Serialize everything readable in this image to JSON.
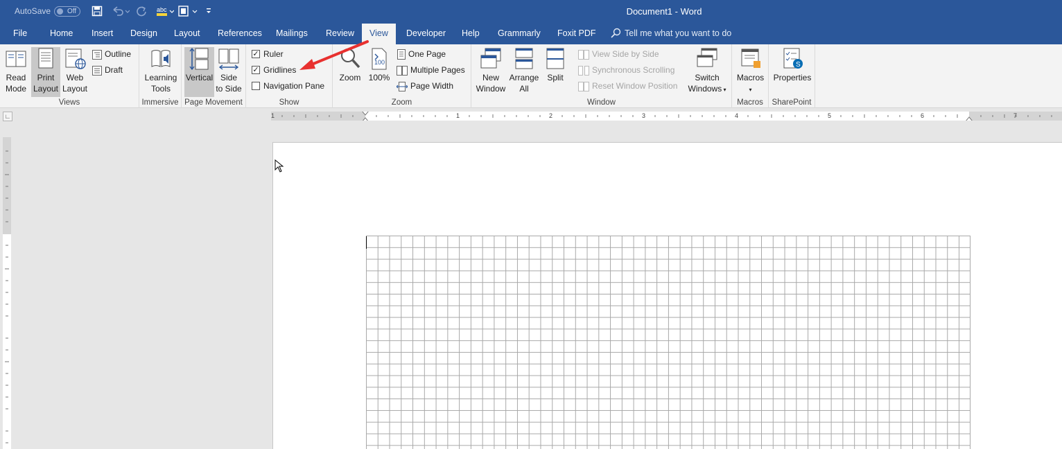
{
  "title_bar": {
    "autosave_label": "AutoSave",
    "autosave_state": "Off",
    "document_title": "Document1 - Word",
    "quick_access": [
      "save-icon",
      "undo-icon",
      "redo-icon",
      "spelling-icon",
      "touch-mode-icon",
      "customize-icon"
    ]
  },
  "tabs": [
    "File",
    "Home",
    "Insert",
    "Design",
    "Layout",
    "References",
    "Mailings",
    "Review",
    "View",
    "Developer",
    "Help",
    "Grammarly",
    "Foxit PDF"
  ],
  "active_tab": "View",
  "tell_me": "Tell me what you want to do",
  "ribbon": {
    "views": {
      "label": "Views",
      "read_mode": [
        "Read",
        "Mode"
      ],
      "print_layout": [
        "Print",
        "Layout"
      ],
      "web_layout": [
        "Web",
        "Layout"
      ],
      "outline": "Outline",
      "draft": "Draft"
    },
    "immersive": {
      "label": "Immersive",
      "learning_tools": [
        "Learning",
        "Tools"
      ]
    },
    "page_movement": {
      "label": "Page Movement",
      "vertical": "Vertical",
      "side_to_side": [
        "Side",
        "to Side"
      ]
    },
    "show": {
      "label": "Show",
      "ruler": "Ruler",
      "gridlines": "Gridlines",
      "navigation_pane": "Navigation Pane",
      "ruler_checked": true,
      "gridlines_checked": true,
      "navigation_pane_checked": false
    },
    "zoom": {
      "label": "Zoom",
      "zoom": "Zoom",
      "hundred": "100%",
      "one_page": "One Page",
      "multiple_pages": "Multiple Pages",
      "page_width": "Page Width"
    },
    "window": {
      "label": "Window",
      "new_window": [
        "New",
        "Window"
      ],
      "arrange_all": [
        "Arrange",
        "All"
      ],
      "split": "Split",
      "view_side_by_side": "View Side by Side",
      "synchronous_scrolling": "Synchronous Scrolling",
      "reset_window_position": "Reset Window Position",
      "switch_windows": [
        "Switch",
        "Windows"
      ]
    },
    "macros": {
      "label": "Macros",
      "macros": "Macros"
    },
    "sharepoint": {
      "label": "SharePoint",
      "properties": "Properties"
    }
  },
  "ruler_numbers": [
    "1",
    "1",
    "2",
    "3",
    "4",
    "5",
    "6",
    "7"
  ],
  "colors": {
    "title_bar": "#2b579a",
    "ribbon": "#f3f3f3",
    "annotation_arrow": "#e8312f",
    "gridlines": "#a8a8a8"
  }
}
